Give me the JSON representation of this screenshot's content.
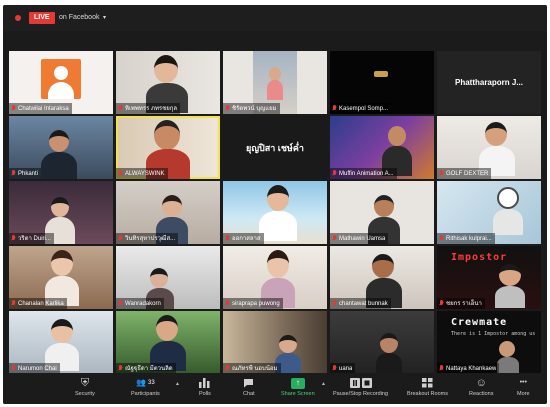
{
  "live": {
    "badge": "LIVE",
    "destination": "on Facebook",
    "caret": "▾"
  },
  "participants": [
    {
      "name": "Chatwilai Intaraksa"
    },
    {
      "name": "หิเพพทรร ภทรชยกุล"
    },
    {
      "name": "ชิรัตพวน์ บุญแยม"
    },
    {
      "name": "Kasempol Somp..."
    },
    {
      "name": "Phattharaporn J...",
      "card": "Phattharaporn J..."
    },
    {
      "name": "Phkanti"
    },
    {
      "name": "ALWAYSWINK"
    },
    {
      "name": "",
      "card": "ยุญปิสา เชษ์ค่ำ"
    },
    {
      "name": "Muffin Animation A..."
    },
    {
      "name": "GOLF DEXTER"
    },
    {
      "name": "วริตา Duiri..."
    },
    {
      "name": "วินทิรสุหาปรวุฒีส..."
    },
    {
      "name": "ออกาสลาส"
    },
    {
      "name": "Mathawin Uamsa"
    },
    {
      "name": "Rithisak kulprai..."
    },
    {
      "name": "Chanalan Karlika"
    },
    {
      "name": "Wanradakorn"
    },
    {
      "name": "siraprapa puwong"
    },
    {
      "name": "chantawat bunnak"
    },
    {
      "name": "ชยกร ราเอ็นา",
      "banner": "Impostor"
    },
    {
      "name": "Narumon Chai"
    },
    {
      "name": "ณัฐฐุธีดา มีตวนลิด"
    },
    {
      "name": "ณภัทรพี นอบน้อม"
    },
    {
      "name": "uana"
    },
    {
      "name": "Nattaya Khankaew",
      "banner": "Crewmate",
      "banner_sub": "There is 1 Impostor among us"
    }
  ],
  "toolbar": [
    {
      "label": "Security",
      "icon": "shield-icon",
      "glyph": "⛨"
    },
    {
      "label": "Participants",
      "icon": "participants-icon",
      "glyph": "👥",
      "badge": "33"
    },
    {
      "label": "Polls",
      "icon": "polls-icon",
      "glyph": "▮"
    },
    {
      "label": "Chat",
      "icon": "chat-icon",
      "glyph": "💬"
    },
    {
      "label": "Share Screen",
      "icon": "share-screen-icon",
      "glyph": "↑"
    },
    {
      "label": "Pause/Stop Recording",
      "icon": "pause-stop-icon",
      "glyph": "⏸⏹"
    },
    {
      "label": "Breakout Rooms",
      "icon": "breakout-rooms-icon",
      "glyph": "⊞"
    },
    {
      "label": "Reactions",
      "icon": "reactions-icon",
      "glyph": "☺"
    },
    {
      "label": "More",
      "icon": "more-icon",
      "glyph": "•••"
    }
  ],
  "colors": {
    "live": "#e53935",
    "share": "#27ae60",
    "active_speaker": "#f0e44a"
  }
}
